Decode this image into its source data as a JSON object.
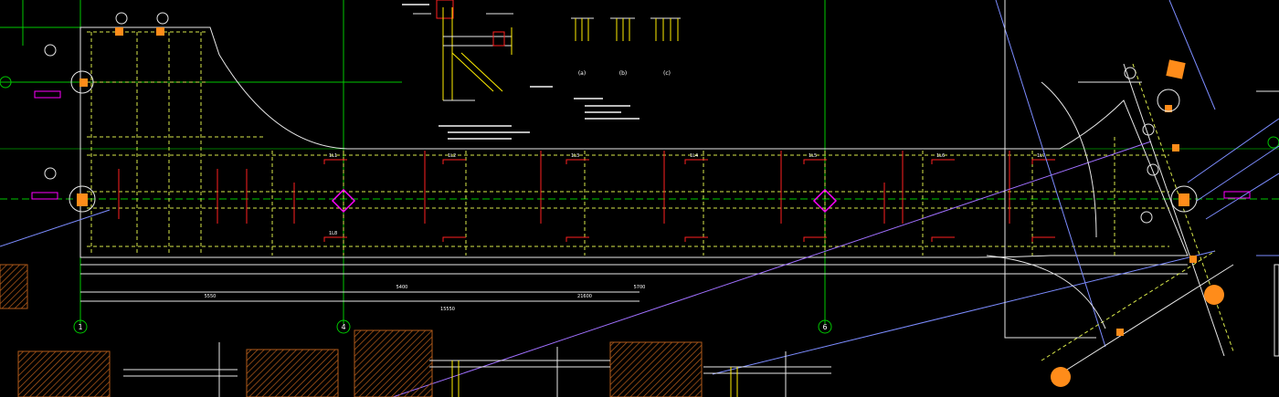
{
  "colors": {
    "background": "#000000",
    "grid_axis": "#00c800",
    "beam": "#e8e8e8",
    "dashed_beam": "#d8e84a",
    "red_mark": "#ff2020",
    "magenta": "#ff00ff",
    "cyan_blue": "#7c8cff",
    "orange_column": "#ff8c1a",
    "hatch_brown": "#b05a1a",
    "yellow": "#ffee00"
  },
  "legend_labels": {
    "detail_a": "(a)",
    "detail_b": "(b)",
    "detail_c": "(c)"
  },
  "axis_bubbles": [
    "1",
    "4",
    "6"
  ],
  "dimensions": {
    "span_1": "5550",
    "span_2": "5400",
    "span_3": "5700",
    "total": "21600",
    "bottom_total": "15550"
  },
  "beam_tags": [
    "1L1",
    "1L2",
    "1L3",
    "1L4",
    "1L5",
    "1L6",
    "1L7",
    "1L8"
  ]
}
